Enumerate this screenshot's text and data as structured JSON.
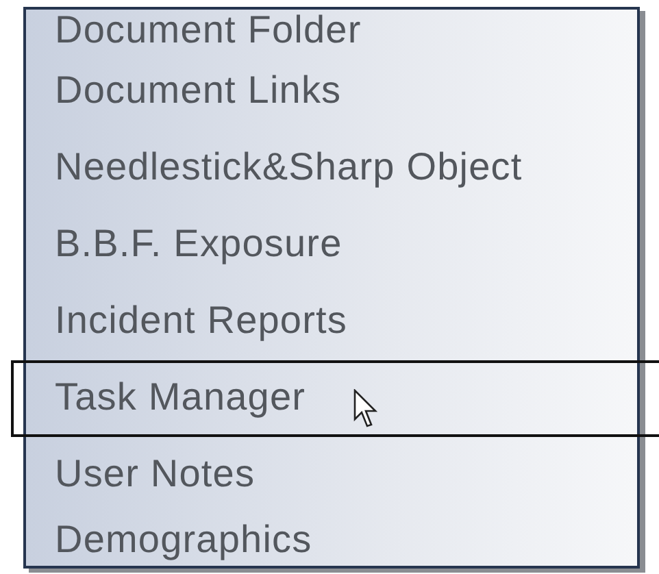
{
  "menu": {
    "items": [
      {
        "label": "Document Folder",
        "selected": false
      },
      {
        "label": "Document Links",
        "selected": false
      },
      {
        "label": "Needlestick&Sharp Object",
        "selected": false
      },
      {
        "label": "B.B.F. Exposure",
        "selected": false
      },
      {
        "label": "Incident Reports",
        "selected": false
      },
      {
        "label": "Task Manager",
        "selected": true
      },
      {
        "label": "User Notes",
        "selected": false
      },
      {
        "label": "Demographics",
        "selected": false
      }
    ]
  }
}
